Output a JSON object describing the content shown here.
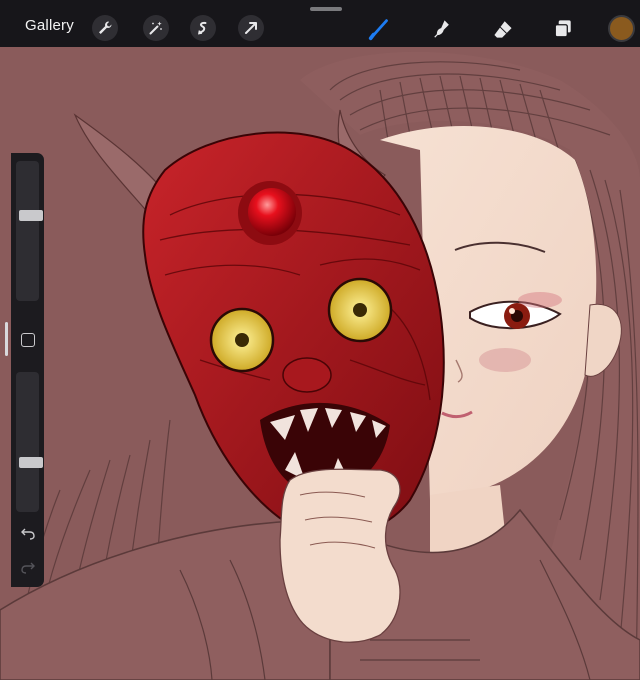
{
  "topbar": {
    "gallery_label": "Gallery",
    "left_tools": [
      "wrench-icon",
      "magic-wand-icon",
      "selection-icon",
      "transform-arrow-icon"
    ],
    "right_tools": [
      "brush-icon",
      "smudge-icon",
      "eraser-icon",
      "layers-icon"
    ],
    "active_tool": "brush-icon",
    "active_color": "#8a5a1e"
  },
  "sidebar": {
    "brush_size_level": 0.62,
    "opacity_level": 0.34,
    "controls": [
      "brush-size-slider",
      "modify-button",
      "opacity-slider",
      "undo-icon",
      "redo-icon"
    ]
  },
  "canvas": {
    "background_color": "#8a5b5b",
    "artwork": "illustration"
  }
}
